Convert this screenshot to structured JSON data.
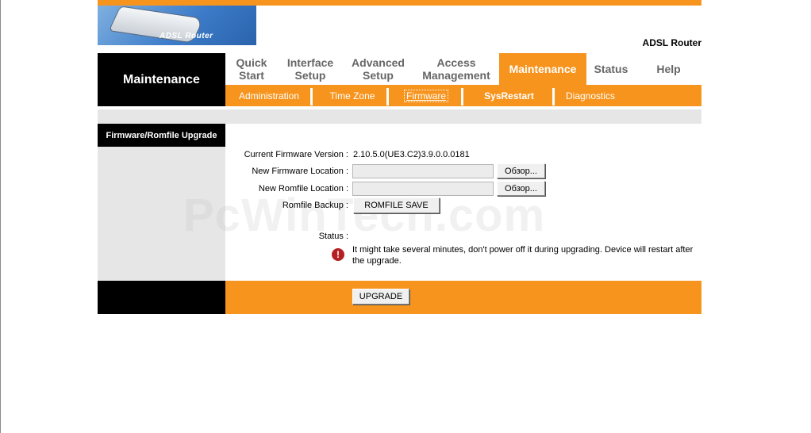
{
  "logo": {
    "text": "ADSL Router",
    "icon": "router-logo"
  },
  "header": {
    "product": "ADSL Router",
    "section": "Maintenance"
  },
  "nav": {
    "tabs": [
      {
        "label": "Quick Start"
      },
      {
        "label": "Interface Setup"
      },
      {
        "label": "Advanced Setup"
      },
      {
        "label": "Access Management"
      },
      {
        "label": "Maintenance",
        "active": true
      },
      {
        "label": "Status"
      },
      {
        "label": "Help"
      }
    ],
    "subtabs": [
      {
        "label": "Administration"
      },
      {
        "label": "Time Zone"
      },
      {
        "label": "Firmware",
        "selected": true
      },
      {
        "label": "SysRestart",
        "bold": true
      },
      {
        "label": "Diagnostics"
      }
    ]
  },
  "page": {
    "side_label": "Firmware/Romfile Upgrade",
    "current_firmware_label": "Current Firmware Version :",
    "current_firmware_value": "2.10.5.0(UE3.C2)3.9.0.0.0181",
    "new_firmware_label": "New Firmware Location :",
    "new_firmware_value": "",
    "new_romfile_label": "New Romfile Location :",
    "new_romfile_value": "",
    "browse_label": "Обзор...",
    "romfile_backup_label": "Romfile Backup :",
    "romfile_save_label": "ROMFILE SAVE",
    "status_label": "Status :",
    "status_message": "It might take several minutes, don't power off it during upgrading. Device will restart after the upgrade.",
    "upgrade_label": "UPGRADE"
  },
  "watermark": "PcWinTech.com",
  "colors": {
    "accent": "#f7941d",
    "dark": "#000000",
    "panel": "#e6e6e6",
    "warning": "#b51f24"
  }
}
